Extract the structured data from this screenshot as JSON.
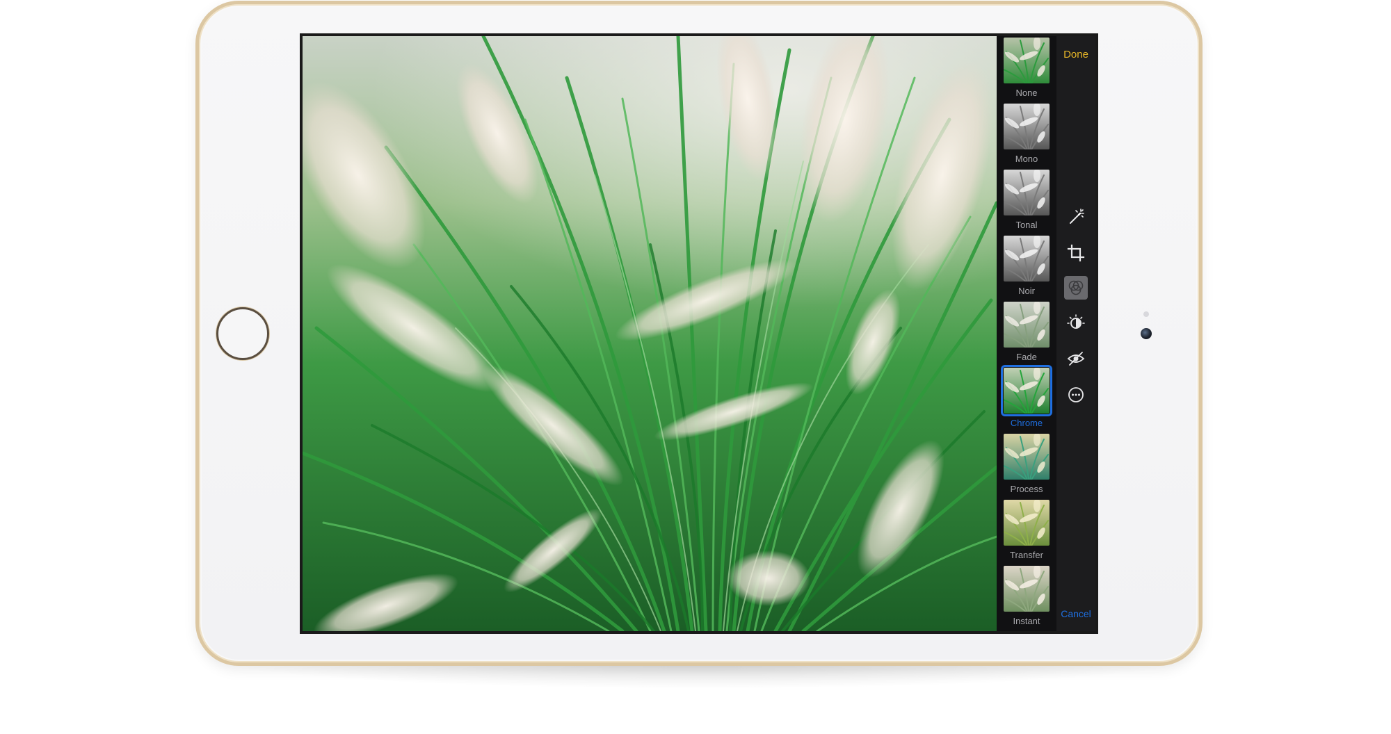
{
  "editor": {
    "done_label": "Done",
    "cancel_label": "Cancel"
  },
  "filters": [
    {
      "label": "None",
      "style": "color"
    },
    {
      "label": "Mono",
      "style": "mono"
    },
    {
      "label": "Tonal",
      "style": "mono"
    },
    {
      "label": "Noir",
      "style": "mono"
    },
    {
      "label": "Fade",
      "style": "fade"
    },
    {
      "label": "Chrome",
      "style": "chrome",
      "selected": true
    },
    {
      "label": "Process",
      "style": "process"
    },
    {
      "label": "Transfer",
      "style": "transfer"
    },
    {
      "label": "Instant",
      "style": "instant"
    }
  ],
  "tools": [
    {
      "icon": "magic-wand-icon"
    },
    {
      "icon": "crop-icon"
    },
    {
      "icon": "filters-icon",
      "active": true
    },
    {
      "icon": "adjust-dial-icon"
    },
    {
      "icon": "red-eye-icon"
    },
    {
      "icon": "more-icon"
    }
  ],
  "colors": {
    "accent_done": "#e7b628",
    "accent_selected": "#1f6fe0",
    "panel_bg": "#1c1c1e",
    "device_gold": "#dcc7a2"
  }
}
